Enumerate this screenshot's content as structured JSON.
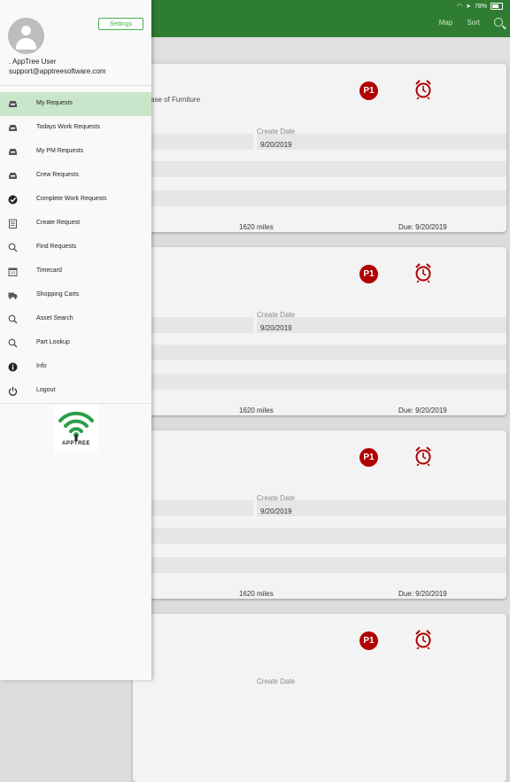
{
  "status": {
    "battery": "78%"
  },
  "appbar": {
    "map_label": "Map",
    "sort_label": "Sort"
  },
  "drawer": {
    "settings_label": "Settings",
    "user_name": ". AppTree User",
    "user_email": "support@apptreesoftware.com",
    "items": [
      {
        "label": "My Requests",
        "icon": "inbox-icon",
        "active": true
      },
      {
        "label": "Todays Work Requests",
        "icon": "inbox-icon"
      },
      {
        "label": "My PM Requests",
        "icon": "inbox-icon"
      },
      {
        "label": "Crew Requests",
        "icon": "inbox-icon"
      },
      {
        "label": "Complete Work Requests",
        "icon": "check-circle-icon"
      },
      {
        "label": "Create Request",
        "icon": "notepad-icon"
      },
      {
        "label": "Find Requests",
        "icon": "search-icon"
      },
      {
        "label": "Timecard",
        "icon": "calendar-icon"
      },
      {
        "label": "Shopping Carts",
        "icon": "truck-icon"
      },
      {
        "label": "Asset Search",
        "icon": "search-icon"
      },
      {
        "label": "Part Lookup",
        "icon": "search-icon"
      },
      {
        "label": "Info",
        "icon": "info-icon"
      },
      {
        "label": "Logout",
        "icon": "power-icon"
      }
    ],
    "logo_text": "APPTREE"
  },
  "cards": [
    {
      "description": "ase of Furniture",
      "priority": "P1",
      "create_date_label": "Create Date",
      "create_date": "9/20/2019",
      "miles": "1620 miles",
      "due": "Due: 9/20/2019"
    },
    {
      "description": "",
      "priority": "P1",
      "create_date_label": "Create Date",
      "create_date": "9/20/2019",
      "miles": "1620 miles",
      "due": "Due: 9/20/2019"
    },
    {
      "description": "",
      "priority": "P1",
      "create_date_label": "Create Date",
      "create_date": "9/20/2019",
      "miles": "1620 miles",
      "due": "Due: 9/20/2019"
    },
    {
      "description": "",
      "priority": "P1",
      "create_date_label": "Create Date",
      "create_date": "",
      "miles": "",
      "due": ""
    }
  ],
  "colors": {
    "accent": "#2e7d32",
    "active_item": "#c8e6c9",
    "priority": "#b00000"
  }
}
